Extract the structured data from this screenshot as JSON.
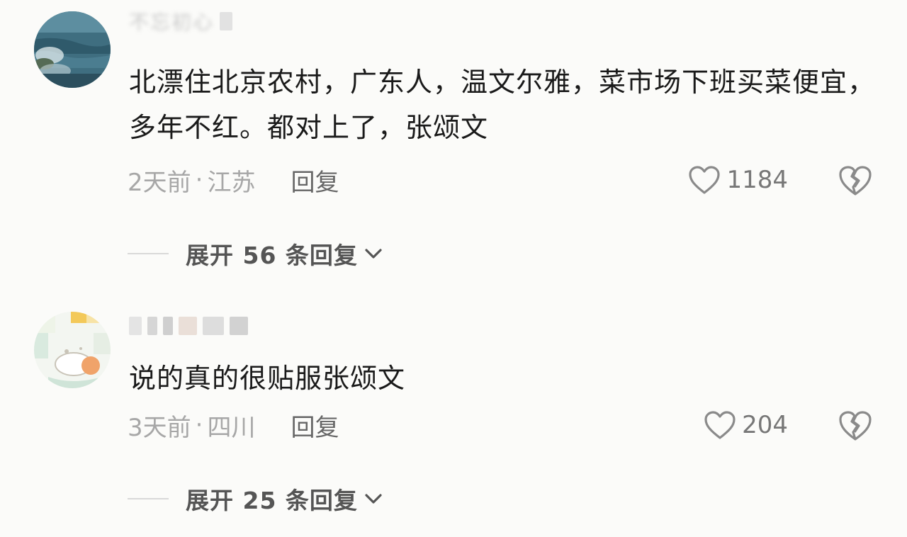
{
  "comments": [
    {
      "username": "不忘初心",
      "text": "北漂住北京农村，广东人，温文尔雅，菜市场下班买菜便宜，多年不红。都对上了，张颂文",
      "time": "2天前",
      "separator": "·",
      "location": "江苏",
      "reply_label": "回复",
      "like_count": "1184",
      "expand_label": "展开 56 条回复",
      "icons": {
        "like": "heart-outline-icon",
        "dislike": "broken-heart-icon",
        "expand": "chevron-down-icon"
      }
    },
    {
      "username": "",
      "text": "说的真的很贴服张颂文",
      "time": "3天前",
      "separator": "·",
      "location": "四川",
      "reply_label": "回复",
      "like_count": "204",
      "expand_label": "展开 25 条回复",
      "icons": {
        "like": "heart-outline-icon",
        "dislike": "broken-heart-icon",
        "expand": "chevron-down-icon"
      }
    }
  ],
  "colors": {
    "background": "#fbfbf9",
    "text": "#1a1a1a",
    "meta": "#a7a7a7",
    "reply": "#666666",
    "icon": "#8a8a8a"
  }
}
